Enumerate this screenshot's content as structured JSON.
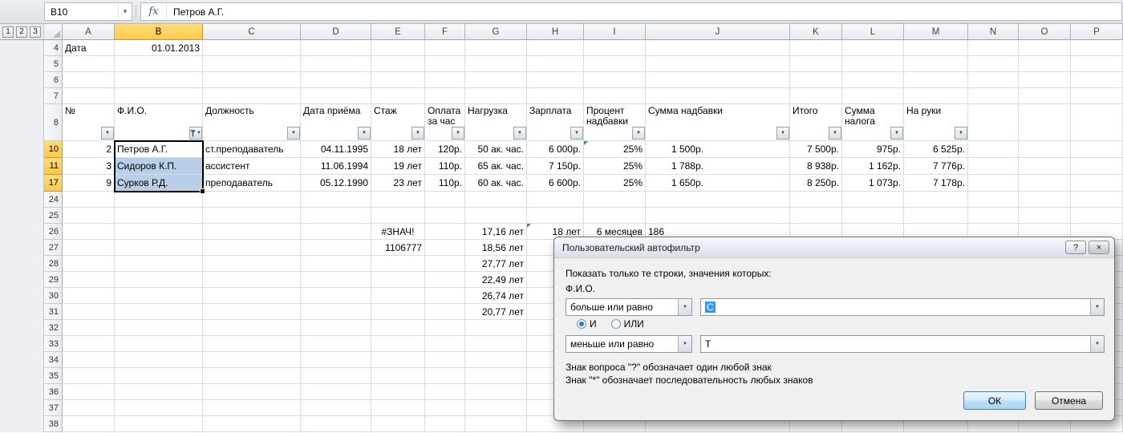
{
  "formula_bar": {
    "cell_ref": "B10",
    "fx_label": "fx",
    "value": "Петров А.Г."
  },
  "icons": {
    "dropdown": "▼",
    "name_box_arrow": "▾",
    "close": "×",
    "help": "?"
  },
  "outline_levels": [
    "1",
    "2",
    "3"
  ],
  "colors": {
    "selection_fill": "#B9CEE7",
    "header_highlight": "#FBC94A",
    "grid_line": "#D6DCE4",
    "smart_tag_green": "#2E9E4F"
  },
  "sheet": {
    "columns": [
      "A",
      "B",
      "C",
      "D",
      "E",
      "F",
      "G",
      "H",
      "I",
      "J",
      "K",
      "L",
      "M",
      "N",
      "O",
      "P"
    ],
    "selected_column": "B",
    "selected_rows": [
      10,
      11,
      17
    ],
    "visible_rows": [
      4,
      5,
      6,
      7,
      8,
      10,
      11,
      17,
      24,
      25,
      26,
      27,
      28,
      29,
      30,
      31,
      32,
      33,
      34,
      35,
      36,
      37,
      38
    ]
  },
  "filter_columns": [
    "A",
    "B",
    "C",
    "D",
    "E",
    "F",
    "G",
    "H",
    "I",
    "J",
    "K",
    "L",
    "M"
  ],
  "filtered_column": "B",
  "cells": [
    {
      "r": 4,
      "c": "A",
      "t": "Дата"
    },
    {
      "r": 4,
      "c": "B",
      "t": "01.01.2013",
      "a": "r"
    },
    {
      "r": 8,
      "c": "A",
      "t": "№"
    },
    {
      "r": 8,
      "c": "B",
      "t": "Ф.И.О."
    },
    {
      "r": 8,
      "c": "C",
      "t": "Должность"
    },
    {
      "r": 8,
      "c": "D",
      "t": "Дата приёма"
    },
    {
      "r": 8,
      "c": "E",
      "t": "Стаж"
    },
    {
      "r": 8,
      "c": "F",
      "t": "Оплата за час"
    },
    {
      "r": 8,
      "c": "G",
      "t": "Нагрузка"
    },
    {
      "r": 8,
      "c": "H",
      "t": "Зарплата"
    },
    {
      "r": 8,
      "c": "I",
      "t": "Процент надбавки"
    },
    {
      "r": 8,
      "c": "J",
      "t": "Сумма надбавки"
    },
    {
      "r": 8,
      "c": "K",
      "t": "Итого"
    },
    {
      "r": 8,
      "c": "L",
      "t": "Сумма налога"
    },
    {
      "r": 8,
      "c": "M",
      "t": "На руки"
    },
    {
      "r": 10,
      "c": "A",
      "t": "2",
      "a": "r"
    },
    {
      "r": 10,
      "c": "B",
      "t": "Петров А.Г.",
      "cls": "active"
    },
    {
      "r": 10,
      "c": "C",
      "t": "ст.преподаватель"
    },
    {
      "r": 10,
      "c": "D",
      "t": "04.11.1995",
      "a": "r"
    },
    {
      "r": 10,
      "c": "E",
      "t": "18 лет",
      "a": "r"
    },
    {
      "r": 10,
      "c": "F",
      "t": "120р.",
      "a": "r"
    },
    {
      "r": 10,
      "c": "G",
      "t": "50 ак. час.",
      "a": "r"
    },
    {
      "r": 10,
      "c": "H",
      "t": "6 000р.",
      "a": "r"
    },
    {
      "r": 10,
      "c": "I",
      "t": "25%",
      "a": "r",
      "tri": 1
    },
    {
      "r": 10,
      "c": "J",
      "t": "1 500р.",
      "a": "r",
      "cls": "jpad"
    },
    {
      "r": 10,
      "c": "K",
      "t": "7 500р.",
      "a": "r"
    },
    {
      "r": 10,
      "c": "L",
      "t": "975р.",
      "a": "r"
    },
    {
      "r": 10,
      "c": "M",
      "t": "6 525р.",
      "a": "r"
    },
    {
      "r": 11,
      "c": "A",
      "t": "3",
      "a": "r"
    },
    {
      "r": 11,
      "c": "B",
      "t": "Сидоров К.П.",
      "cls": "selfill"
    },
    {
      "r": 11,
      "c": "C",
      "t": "ассистент"
    },
    {
      "r": 11,
      "c": "D",
      "t": "11.06.1994",
      "a": "r"
    },
    {
      "r": 11,
      "c": "E",
      "t": "19 лет",
      "a": "r"
    },
    {
      "r": 11,
      "c": "F",
      "t": "110р.",
      "a": "r"
    },
    {
      "r": 11,
      "c": "G",
      "t": "65 ак. час.",
      "a": "r"
    },
    {
      "r": 11,
      "c": "H",
      "t": "7 150р.",
      "a": "r"
    },
    {
      "r": 11,
      "c": "I",
      "t": "25%",
      "a": "r"
    },
    {
      "r": 11,
      "c": "J",
      "t": "1 788р.",
      "a": "r",
      "cls": "jpad"
    },
    {
      "r": 11,
      "c": "K",
      "t": "8 938р.",
      "a": "r"
    },
    {
      "r": 11,
      "c": "L",
      "t": "1 162р.",
      "a": "r"
    },
    {
      "r": 11,
      "c": "M",
      "t": "7 776р.",
      "a": "r"
    },
    {
      "r": 17,
      "c": "A",
      "t": "9",
      "a": "r"
    },
    {
      "r": 17,
      "c": "B",
      "t": "Сурков Р.Д.",
      "cls": "selfill"
    },
    {
      "r": 17,
      "c": "C",
      "t": "преподаватель"
    },
    {
      "r": 17,
      "c": "D",
      "t": "05.12.1990",
      "a": "r"
    },
    {
      "r": 17,
      "c": "E",
      "t": "23 лет",
      "a": "r"
    },
    {
      "r": 17,
      "c": "F",
      "t": "110р.",
      "a": "r"
    },
    {
      "r": 17,
      "c": "G",
      "t": "60 ак. час.",
      "a": "r"
    },
    {
      "r": 17,
      "c": "H",
      "t": "6 600р.",
      "a": "r"
    },
    {
      "r": 17,
      "c": "I",
      "t": "25%",
      "a": "r"
    },
    {
      "r": 17,
      "c": "J",
      "t": "1 650р.",
      "a": "r",
      "cls": "jpad"
    },
    {
      "r": 17,
      "c": "K",
      "t": "8 250р.",
      "a": "r"
    },
    {
      "r": 17,
      "c": "L",
      "t": "1 073р.",
      "a": "r"
    },
    {
      "r": 17,
      "c": "M",
      "t": "7 178р.",
      "a": "r"
    },
    {
      "r": 26,
      "c": "E",
      "t": "#ЗНАЧ!",
      "a": "c"
    },
    {
      "r": 26,
      "c": "G",
      "t": "17,16 лет",
      "a": "r"
    },
    {
      "r": 26,
      "c": "H",
      "t": "18 лет",
      "a": "r",
      "tri": 1
    },
    {
      "r": 26,
      "c": "I",
      "t": "6 месяцев",
      "a": "r"
    },
    {
      "r": 26,
      "c": "J",
      "t": "186"
    },
    {
      "r": 27,
      "c": "E",
      "t": "1106777",
      "a": "r"
    },
    {
      "r": 27,
      "c": "G",
      "t": "18,56 лет",
      "a": "r"
    },
    {
      "r": 28,
      "c": "G",
      "t": "27,77 лет",
      "a": "r"
    },
    {
      "r": 29,
      "c": "G",
      "t": "22,49 лет",
      "a": "r"
    },
    {
      "r": 30,
      "c": "G",
      "t": "26,74 лет",
      "a": "r"
    },
    {
      "r": 31,
      "c": "G",
      "t": "20,77 лет",
      "a": "r"
    }
  ],
  "dialog": {
    "title": "Пользовательский автофильтр",
    "help_label": "?",
    "intro": "Показать только те строки, значения которых:",
    "field": "Ф.И.О.",
    "cond1": "больше или равно",
    "value1": "С",
    "and_label": "И",
    "or_label": "ИЛИ",
    "cond2": "меньше или равно",
    "value2": "Т",
    "hint1": "Знак вопроса \"?\" обозначает один любой знак",
    "hint2": "Знак \"*\" обозначает последовательность любых знаков",
    "ok_label": "ОК",
    "cancel_label": "Отмена"
  }
}
